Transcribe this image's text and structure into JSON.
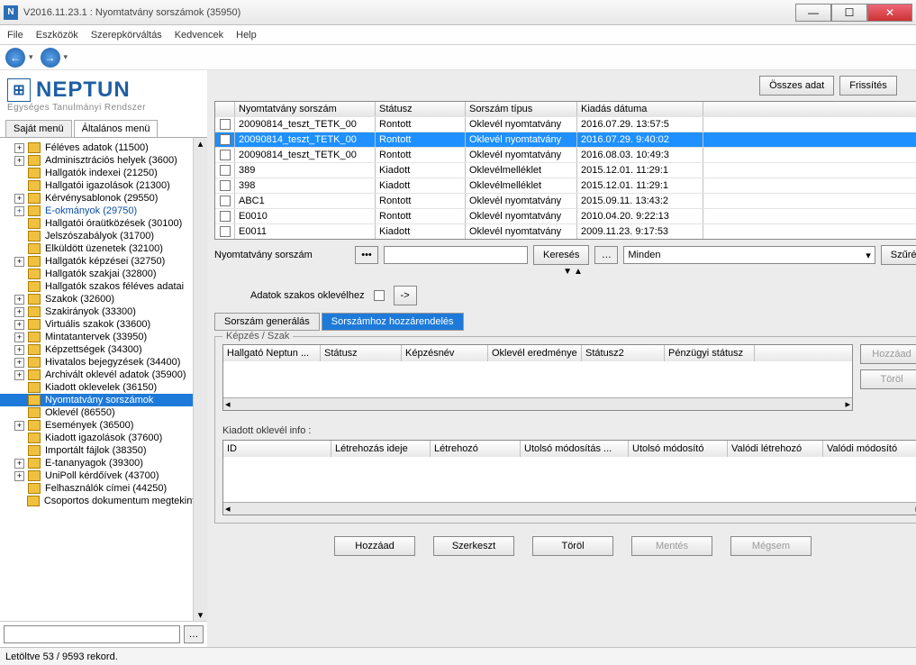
{
  "window": {
    "title": "V2016.11.23.1 : Nyomtatvány sorszámok (35950)"
  },
  "menu": {
    "file": "File",
    "tools": "Eszközök",
    "role": "Szerepkörváltás",
    "fav": "Kedvencek",
    "help": "Help"
  },
  "logo": {
    "text": "NEPTUN",
    "sub": "Egységes Tanulmányi Rendszer"
  },
  "left_tabs": {
    "own": "Saját menü",
    "general": "Általános menü"
  },
  "tree": [
    {
      "pm": "+",
      "label": "Féléves adatok (11500)"
    },
    {
      "pm": "+",
      "label": "Adminisztrációs helyek (3600)"
    },
    {
      "pm": "",
      "label": "Hallgatók indexei (21250)"
    },
    {
      "pm": "",
      "label": "Hallgatói igazolások (21300)"
    },
    {
      "pm": "+",
      "label": "Kérvénysablonok (29550)"
    },
    {
      "pm": "+",
      "label": "E-okmányok (29750)",
      "link": true
    },
    {
      "pm": "",
      "label": "Hallgatói óraütközések (30100)"
    },
    {
      "pm": "",
      "label": "Jelszószabályok (31700)"
    },
    {
      "pm": "",
      "label": "Elküldött üzenetek (32100)"
    },
    {
      "pm": "+",
      "label": "Hallgatók képzései (32750)"
    },
    {
      "pm": "",
      "label": "Hallgatók szakjai (32800)"
    },
    {
      "pm": "",
      "label": "Hallgatók szakos féléves adatai"
    },
    {
      "pm": "+",
      "label": "Szakok (32600)"
    },
    {
      "pm": "+",
      "label": "Szakirányok (33300)"
    },
    {
      "pm": "+",
      "label": "Virtuális szakok (33600)"
    },
    {
      "pm": "+",
      "label": "Mintatantervek (33950)"
    },
    {
      "pm": "+",
      "label": "Képzettségek (34300)"
    },
    {
      "pm": "+",
      "label": "Hivatalos bejegyzések (34400)"
    },
    {
      "pm": "+",
      "label": "Archivált oklevél adatok (35900)"
    },
    {
      "pm": "",
      "label": "Kiadott oklevelek (36150)"
    },
    {
      "pm": "",
      "label": "Nyomtatvány sorszámok",
      "sel": true
    },
    {
      "pm": "",
      "label": "Oklevél (86550)"
    },
    {
      "pm": "+",
      "label": "Események (36500)"
    },
    {
      "pm": "",
      "label": "Kiadott igazolások (37600)"
    },
    {
      "pm": "",
      "label": "Importált fájlok (38350)"
    },
    {
      "pm": "+",
      "label": "E-tananyagok (39300)"
    },
    {
      "pm": "+",
      "label": "UniPoll kérdőívek (43700)"
    },
    {
      "pm": "",
      "label": "Felhasználók címei (44250)"
    },
    {
      "pm": "",
      "label": "Csoportos dokumentum megtekintés"
    }
  ],
  "top_buttons": {
    "all": "Összes adat",
    "refresh": "Frissítés"
  },
  "grid": {
    "headers": {
      "a": "Nyomtatvány sorszám",
      "b": "Státusz",
      "c": "Sorszám típus",
      "d": "Kiadás dátuma"
    },
    "rows": [
      {
        "a": "20090814_teszt_TETK_00",
        "b": "Rontott",
        "c": "Oklevél nyomtatvány",
        "d": "2016.07.29. 13:57:5"
      },
      {
        "a": "20090814_teszt_TETK_00",
        "b": "Rontott",
        "c": "Oklevél nyomtatvány",
        "d": "2016.07.29. 9:40:02",
        "sel": true
      },
      {
        "a": "20090814_teszt_TETK_00",
        "b": "Rontott",
        "c": "Oklevél nyomtatvány",
        "d": "2016.08.03. 10:49:3"
      },
      {
        "a": "389",
        "b": "Kiadott",
        "c": "Oklevélmelléklet",
        "d": "2015.12.01. 11:29:1"
      },
      {
        "a": "398",
        "b": "Kiadott",
        "c": "Oklevélmelléklet",
        "d": "2015.12.01. 11:29:1"
      },
      {
        "a": "ABC1",
        "b": "Rontott",
        "c": "Oklevél nyomtatvány",
        "d": "2015.09.11. 13:43:2"
      },
      {
        "a": "E0010",
        "b": "Rontott",
        "c": "Oklevél nyomtatvány",
        "d": "2010.04.20. 9:22:13"
      },
      {
        "a": "E0011",
        "b": "Kiadott",
        "c": "Oklevél nyomtatvány",
        "d": "2009.11.23. 9:17:53"
      }
    ]
  },
  "search": {
    "label": "Nyomtatvány sorszám",
    "btn": "Keresés",
    "sel": "Minden",
    "filter": "Szűrés"
  },
  "adat": {
    "label": "Adatok szakos oklevélhez",
    "arrow": "->"
  },
  "tabs2": {
    "gen": "Sorszám generálás",
    "assign": "Sorszámhoz hozzárendelés"
  },
  "group1": {
    "title": "Képzés / Szak",
    "headers": {
      "a": "Hallgató Neptun ...",
      "b": "Státusz",
      "c": "Képzésnév",
      "d": "Oklevél eredménye",
      "e": "Státusz2",
      "f": "Pénzügyi státusz"
    },
    "add": "Hozzáad",
    "del": "Töröl"
  },
  "info": {
    "label": "Kiadott oklevél info :",
    "headers": {
      "a": "ID",
      "b": "Létrehozás ideje",
      "c": "Létrehozó",
      "d": "Utolsó módosítás ...",
      "e": "Utolsó módosító",
      "f": "Valódi létrehozó",
      "g": "Valódi módosító"
    }
  },
  "bottom": {
    "add": "Hozzáad",
    "edit": "Szerkeszt",
    "del": "Töröl",
    "save": "Mentés",
    "cancel": "Mégsem"
  },
  "status": {
    "text": "Letöltve 53 / 9593 rekord."
  }
}
